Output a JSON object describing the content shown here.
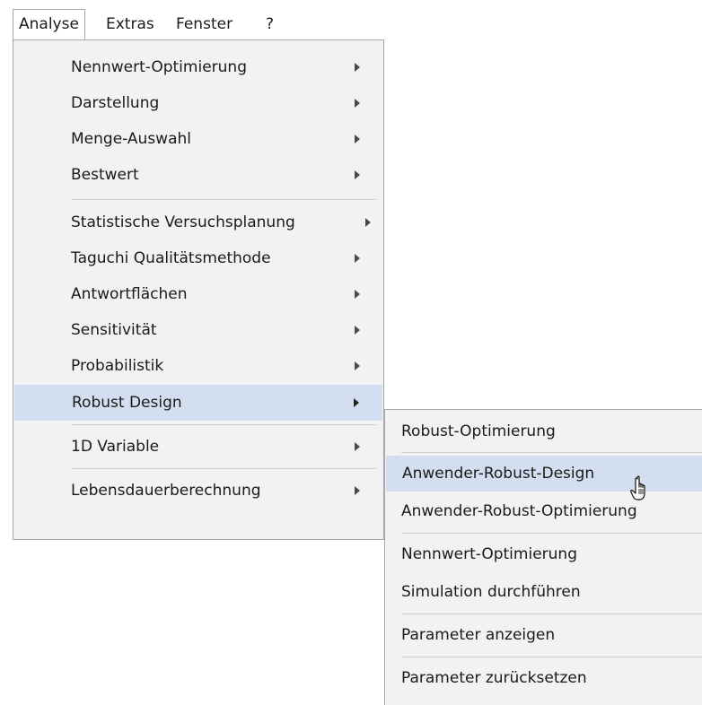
{
  "menubar": {
    "items": [
      "Analyse",
      "Extras",
      "Fenster",
      "?"
    ]
  },
  "menu": {
    "items": [
      {
        "label": "Nennwert-Optimierung",
        "has_submenu": true
      },
      {
        "label": "Darstellung",
        "has_submenu": true
      },
      {
        "label": "Menge-Auswahl",
        "has_submenu": true
      },
      {
        "label": "Bestwert",
        "has_submenu": true
      },
      {
        "label": "Statistische Versuchsplanung",
        "has_submenu": true
      },
      {
        "label": "Taguchi Qualitätsmethode",
        "has_submenu": true
      },
      {
        "label": "Antwortflächen",
        "has_submenu": true
      },
      {
        "label": "Sensitivität",
        "has_submenu": true
      },
      {
        "label": "Probabilistik",
        "has_submenu": true
      },
      {
        "label": "Robust Design",
        "has_submenu": true,
        "highlighted": true
      },
      {
        "label": "1D Variable",
        "has_submenu": true
      },
      {
        "label": "Lebensdauerberechnung",
        "has_submenu": true
      }
    ]
  },
  "submenu": {
    "items": [
      {
        "label": "Robust-Optimierung"
      },
      {
        "label": "Anwender-Robust-Design",
        "highlighted": true
      },
      {
        "label": "Anwender-Robust-Optimierung"
      },
      {
        "label": "Nennwert-Optimierung"
      },
      {
        "label": "Simulation durchführen"
      },
      {
        "label": "Parameter anzeigen"
      },
      {
        "label": "Parameter zurücksetzen"
      }
    ]
  },
  "cursor": {
    "icon": "hand-pointer-icon"
  },
  "colors": {
    "menu_background": "#f2f2f2",
    "highlight": "#d3dff0",
    "border": "#a8a8a8",
    "separator": "#cfcfcf"
  }
}
